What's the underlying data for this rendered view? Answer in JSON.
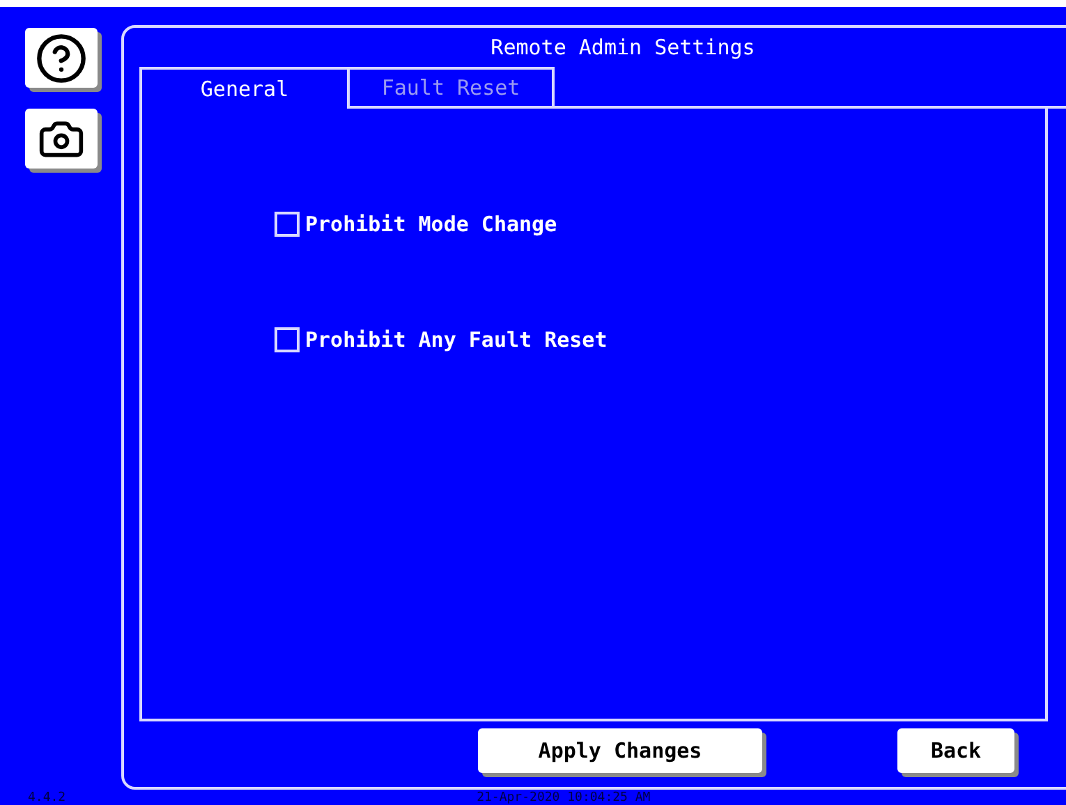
{
  "title": "Remote Admin Settings",
  "tabs": [
    {
      "label": "General",
      "selected": true
    },
    {
      "label": "Fault Reset",
      "selected": false
    }
  ],
  "options": [
    {
      "label": "Prohibit Mode Change",
      "checked": false
    },
    {
      "label": "Prohibit Any Fault Reset",
      "checked": false
    }
  ],
  "buttons": [
    "Apply Changes",
    "Back"
  ],
  "status_bar": {
    "version": "4.4.2",
    "datetime": "21-Apr-2020 10:04:25 AM"
  }
}
